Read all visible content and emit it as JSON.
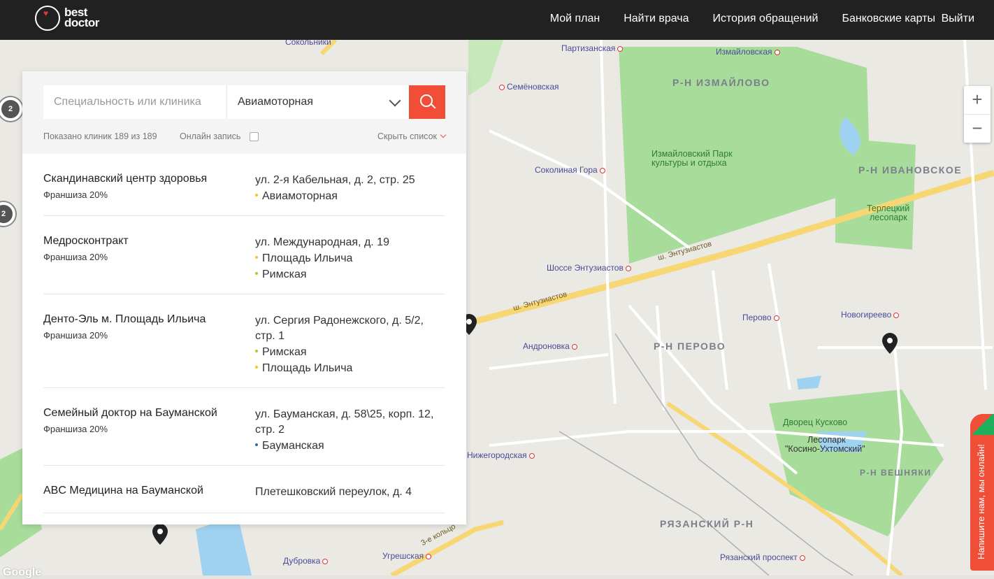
{
  "header": {
    "logo_line1": "best",
    "logo_line2": "doctor",
    "nav": [
      "Мой план",
      "Найти врача",
      "История обращений",
      "Банковские карты"
    ],
    "nav_separator": "·",
    "logout": "Выйти"
  },
  "search": {
    "specialty_placeholder": "Специальность или клиника",
    "station_value": "Авиамоторная",
    "shown_text": "Показано клиник 189 из 189",
    "online_label": "Онлайн запись",
    "online_checked": false,
    "hide_list": "Скрыть список"
  },
  "clinics": [
    {
      "name": "Скандинавский центр здоровья",
      "franchise": "Франшиза 20%",
      "address": "ул. 2-я Кабельная, д. 2, стр. 25",
      "metro": [
        {
          "name": "Авиамоторная",
          "color": "#f5c518"
        }
      ]
    },
    {
      "name": "Медросконтракт",
      "franchise": "Франшиза 20%",
      "address": "ул. Международная, д. 19",
      "metro": [
        {
          "name": "Площадь Ильича",
          "color": "#f5c518"
        },
        {
          "name": "Римская",
          "color": "#a5d020"
        }
      ]
    },
    {
      "name": "Денто-Эль м. Площадь Ильича",
      "franchise": "Франшиза 20%",
      "address": "ул. Сергия Радонежского, д. 5/2, стр. 1",
      "metro": [
        {
          "name": "Римская",
          "color": "#a5d020"
        },
        {
          "name": "Площадь Ильича",
          "color": "#f5c518"
        }
      ]
    },
    {
      "name": "Семейный доктор на Бауманской",
      "franchise": "Франшиза 20%",
      "address": "ул. Бауманская, д. 58\\25, корп. 12, стр. 2",
      "metro": [
        {
          "name": "Бауманская",
          "color": "#1f6fbf"
        }
      ]
    },
    {
      "name": "ABC Медицина на Бауманской",
      "franchise": "",
      "address": "Плетешковский переулок, д. 4",
      "metro": []
    }
  ],
  "map": {
    "zoom_in": "+",
    "zoom_out": "−",
    "clusters": [
      "2",
      "2"
    ],
    "google": "Google",
    "labels": {
      "district_izmailovo": "Р-Н ИЗМАЙЛОВО",
      "district_ivanovskoe": "Р-Н ИВАНОВСКОЕ",
      "district_perovo": "Р-Н ПЕРОВО",
      "district_veshnyaki": "Р-Н ВЕШНЯКИ",
      "district_ryazansky": "РЯЗАНСКИЙ Р-Н",
      "park_izmailovsky_1": "Измайловский Парк",
      "park_izmailovsky_2": "культуры и отдыха",
      "park_terletsky_1": "Терлецкий",
      "park_terletsky_2": "лесопарк",
      "park_kuskovo": "Дворец Кусково",
      "park_kosino_1": "Лесопарк",
      "park_kosino_2": "\"Косино-Ухтомский\"",
      "st_partizanskaya": "Партизанская",
      "st_izmailovskaya": "Измайловская",
      "st_semenovskaya": "Семёновская",
      "st_sokolnaya_gora": "Соколиная Гора",
      "st_shosse_entuziastov": "Шоссе Энтузиастов",
      "st_perovo": "Перово",
      "st_novogireevo": "Новогиреево",
      "st_andronovka": "Андроновка",
      "st_nizhegorodskaya": "Нижегородская",
      "st_ugreshskaya": "Угрешская",
      "st_dubrovka": "Дубровка",
      "st_ryazansky_prospekt": "Рязанский проспект",
      "st_sokolniki": "Сокольники",
      "road_entuziastov": "ш. Энтузиастов",
      "road_3e_koltso": "3-е кольцо"
    }
  },
  "chat": {
    "text": "Напишите нам, мы онлайн!"
  }
}
